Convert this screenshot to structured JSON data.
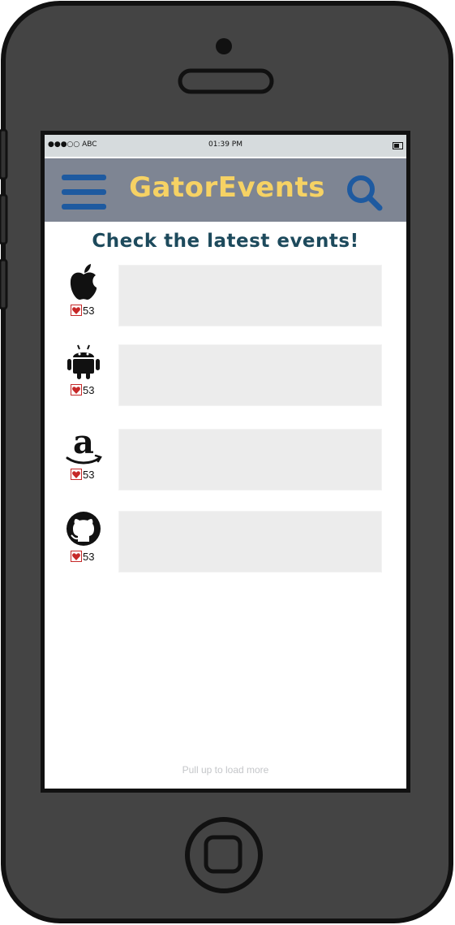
{
  "status_bar": {
    "carrier": "●●●○○ ABC",
    "time": "01:39 PM"
  },
  "navbar": {
    "title": "GatorEvents",
    "menu_icon": "hamburger-menu-icon",
    "search_icon": "search-icon"
  },
  "headline": "Check the latest events!",
  "events": [
    {
      "logo": "apple-logo-icon",
      "likes": "53"
    },
    {
      "logo": "android-logo-icon",
      "likes": "53"
    },
    {
      "logo": "amazon-logo-icon",
      "likes": "53"
    },
    {
      "logo": "github-logo-icon",
      "likes": "53"
    }
  ],
  "footer": {
    "load_more": "Pull up to load more"
  },
  "colors": {
    "navbar": "#7e8593",
    "title": "#f6d264",
    "icon": "#1e5aa0",
    "headline": "#1d4a5c",
    "phone_body": "#444444",
    "heart": "#c62828"
  }
}
